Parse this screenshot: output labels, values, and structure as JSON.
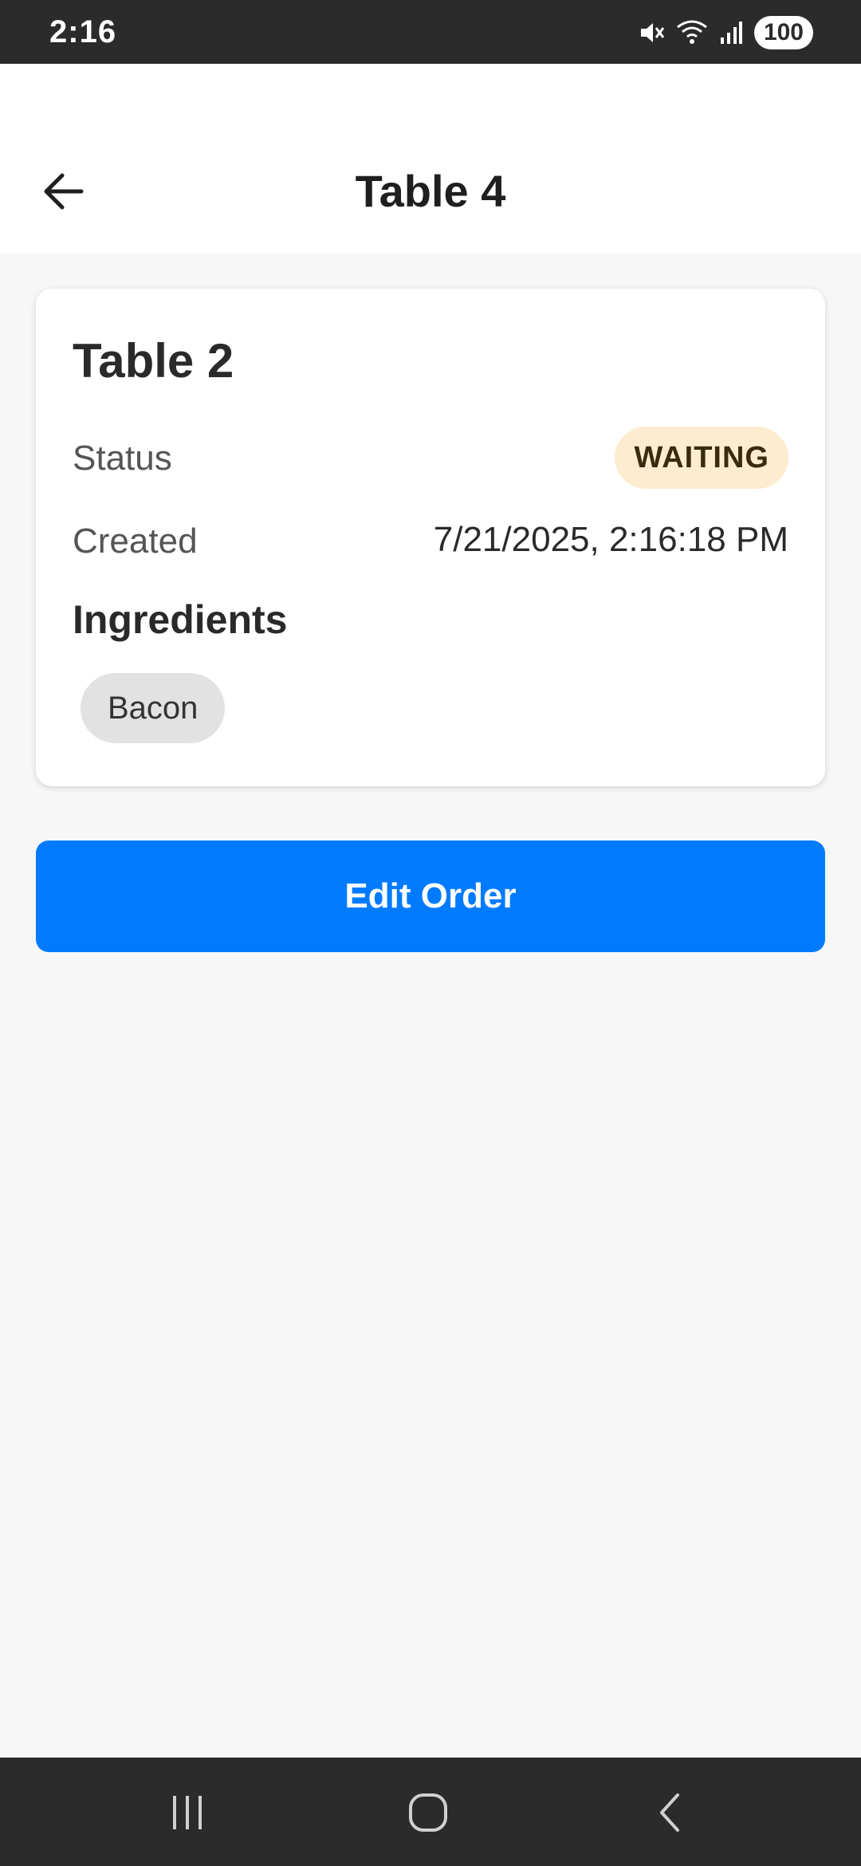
{
  "status_bar": {
    "time": "2:16",
    "battery": "100",
    "icons": [
      "mute-icon",
      "wifi-icon",
      "signal-icon",
      "battery-icon"
    ]
  },
  "header": {
    "title": "Table 4",
    "back_icon": "arrow-left-icon"
  },
  "order_card": {
    "title": "Table 2",
    "status_label": "Status",
    "status_value": "WAITING",
    "created_label": "Created",
    "created_value": "7/21/2025, 2:16:18 PM",
    "ingredients_heading": "Ingredients",
    "ingredients": [
      "Bacon"
    ]
  },
  "actions": {
    "edit_label": "Edit Order"
  },
  "nav_bar": {
    "buttons": [
      "recent-apps-icon",
      "home-icon",
      "back-icon"
    ]
  },
  "colors": {
    "accent": "#007bff",
    "status_badge_bg": "#fdecd0",
    "chip_bg": "#e2e2e2",
    "system_bar": "#2b2b2b"
  }
}
